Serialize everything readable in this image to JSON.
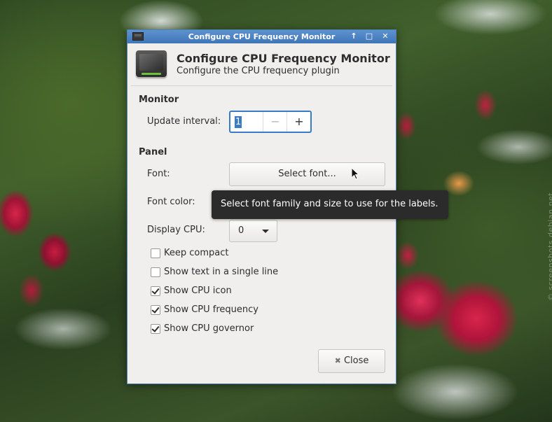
{
  "window": {
    "titlebar_title": "Configure CPU Frequency Monitor",
    "header_title": "Configure CPU Frequency Monitor",
    "header_subtitle": "Configure the CPU frequency plugin"
  },
  "monitor": {
    "section_label": "Monitor",
    "update_interval_label": "Update interval:",
    "update_interval_value": "1",
    "minus_symbol": "−",
    "plus_symbol": "+"
  },
  "panel": {
    "section_label": "Panel",
    "font_label": "Font:",
    "font_button_label": "Select font...",
    "font_color_label": "Font color:",
    "font_color_value": "#000000",
    "display_cpu_label": "Display CPU:",
    "display_cpu_value": "0"
  },
  "checkboxes": [
    {
      "label": "Keep compact",
      "checked": false
    },
    {
      "label": "Show text in a single line",
      "checked": false
    },
    {
      "label": "Show CPU icon",
      "checked": true
    },
    {
      "label": "Show CPU frequency",
      "checked": true
    },
    {
      "label": "Show CPU governor",
      "checked": true
    }
  ],
  "tooltip": "Select font family and size to use for the labels.",
  "close_button_label": "Close",
  "close_icon_glyph": "✖",
  "watermark": "© screenshots.debian.net",
  "colors": {
    "accent": "#3a7bc6",
    "titlebar": "#4f86c6"
  }
}
